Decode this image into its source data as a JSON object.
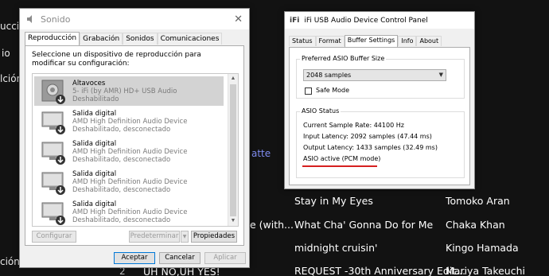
{
  "background": {
    "left_texts": [
      "ucció",
      "io",
      "lción",
      "ción"
    ],
    "atte": "atte",
    "tracks": [
      {
        "prev": "",
        "title": "Stay in My Eyes",
        "artist": "Tomoko Aran"
      },
      {
        "prev": "e (with...",
        "title": "What Cha' Gonna Do for Me",
        "artist": "Chaka Khan"
      },
      {
        "prev": "",
        "title": "midnight cruisin'",
        "artist": "Kingo Hamada"
      },
      {
        "prev": "UH NO,UH YES!",
        "title": "REQUEST -30th Anniversary Edit...",
        "artist": "Mariya Takeuchi"
      }
    ],
    "last_num": "2"
  },
  "sound_dialog": {
    "title": "Sonido",
    "tabs": [
      "Reproducción",
      "Grabación",
      "Sonidos",
      "Comunicaciones"
    ],
    "active_tab": 0,
    "instructions": "Seleccione un dispositivo de reproducción para modificar su configuración:",
    "devices": [
      {
        "name": "Altavoces",
        "driver": "5- iFi (by AMR) HD+ USB Audio",
        "status": "Deshabilitado",
        "selected": true
      },
      {
        "name": "Salida digital",
        "driver": "AMD High Definition Audio Device",
        "status": "Deshabilitado, desconectado",
        "selected": false
      },
      {
        "name": "Salida digital",
        "driver": "AMD High Definition Audio Device",
        "status": "Deshabilitado, desconectado",
        "selected": false
      },
      {
        "name": "Salida digital",
        "driver": "AMD High Definition Audio Device",
        "status": "Deshabilitado, desconectado",
        "selected": false
      },
      {
        "name": "Salida digital",
        "driver": "AMD High Definition Audio Device",
        "status": "Deshabilitado, desconectado",
        "selected": false
      }
    ],
    "buttons": {
      "configure": "Configurar",
      "set_default": "Predeterminar",
      "properties": "Propiedades",
      "ok": "Aceptar",
      "cancel": "Cancelar",
      "apply": "Aplicar"
    },
    "close_glyph": "✕"
  },
  "ifi_dialog": {
    "logo": "iFi",
    "title": "iFi USB Audio Device Control Panel",
    "tabs": [
      "Status",
      "Format",
      "Buffer Settings",
      "Info",
      "About"
    ],
    "active_tab": 2,
    "buffer_group_label": "Preferred ASIO Buffer Size",
    "buffer_value": "2048 samples",
    "safe_mode_label": "Safe Mode",
    "safe_mode_checked": false,
    "asio_group_label": "ASIO Status",
    "status_lines": [
      "Current Sample Rate: 44100 Hz",
      "Input Latency: 2092 samples (47.44 ms)",
      "Output Latency: 1433 samples (32.49 ms)",
      "ASIO active (PCM mode)"
    ],
    "highlight_color": "#d62020"
  }
}
